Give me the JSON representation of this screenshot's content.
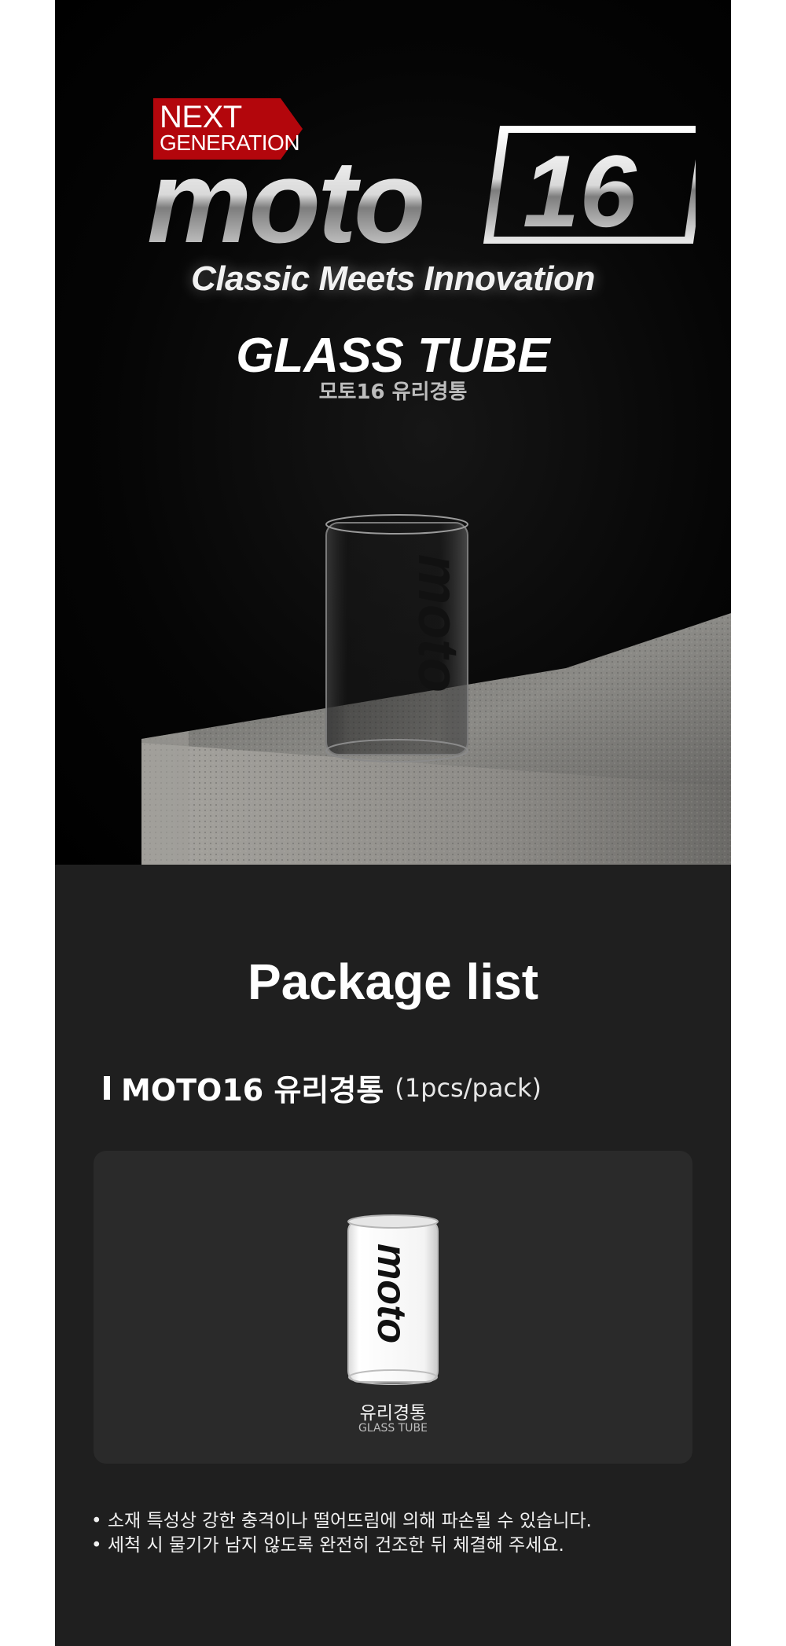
{
  "hero": {
    "badge_line1": "NEXT",
    "badge_line2": "GENERATION",
    "brand_word": "moto",
    "brand_number": "16",
    "tagline": "Classic Meets Innovation",
    "product_title": "GLASS TUBE",
    "product_subtitle": "모토16 유리경통",
    "tube_logo_text": "moto",
    "colors": {
      "badge_red": "#b3060c",
      "background": "#000000"
    }
  },
  "package": {
    "title": "Package list",
    "item_name": "MOTO16 유리경통",
    "item_qty": "(1pcs/pack)",
    "card_label_ko": "유리경통",
    "card_label_en": "GLASS TUBE",
    "card_tube_text": "moto"
  },
  "notes": [
    "• 소재 특성상 강한 충격이나 떨어뜨림에 의해 파손될 수 있습니다.",
    "• 세척 시 물기가 남지 않도록 완전히 건조한 뒤 체결해 주세요."
  ]
}
